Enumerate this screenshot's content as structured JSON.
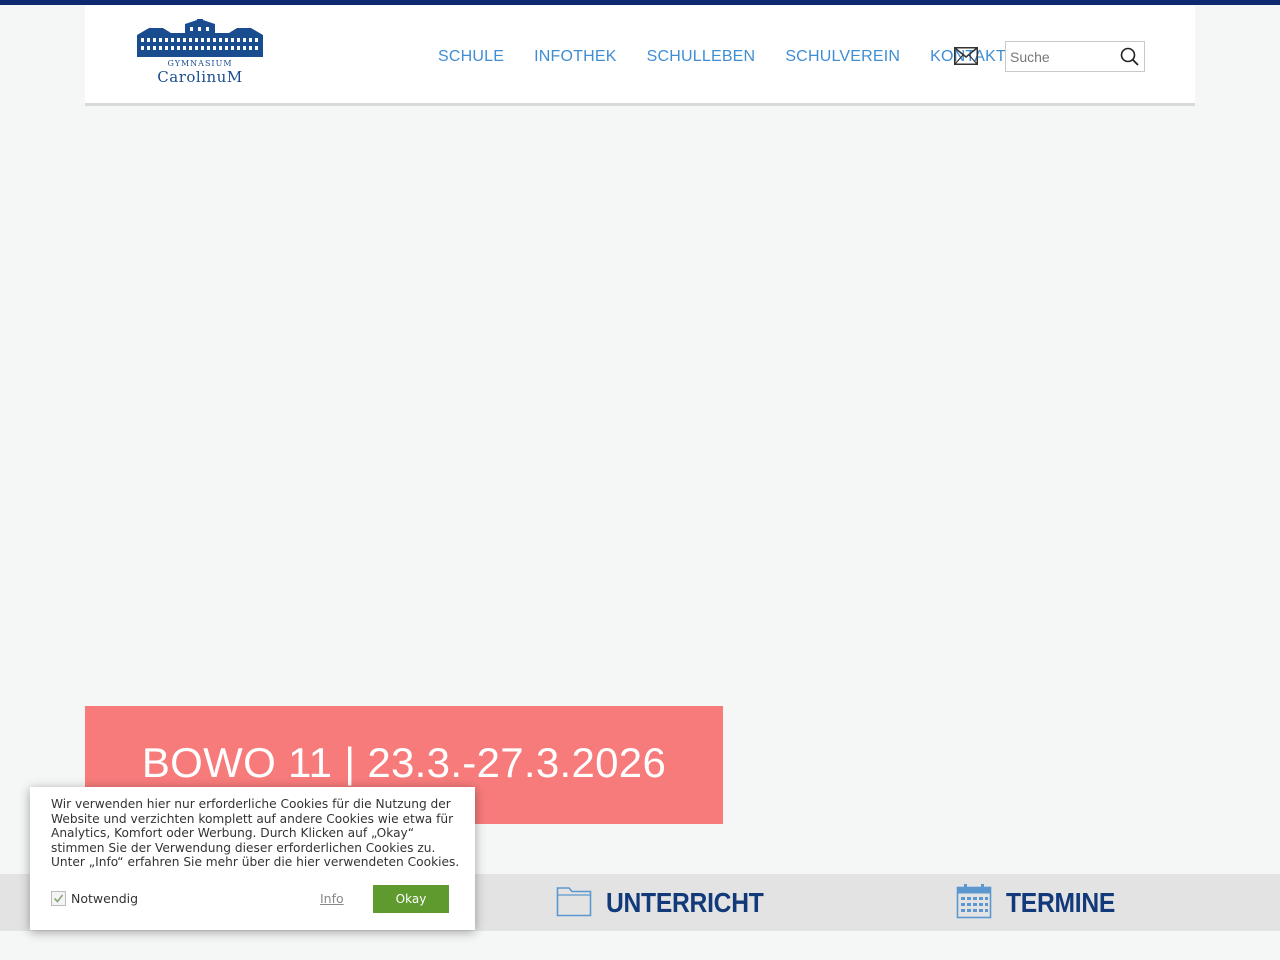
{
  "header": {
    "logo": {
      "line1": "GYMNASIUM",
      "line2": "CarolinuM"
    },
    "nav": [
      {
        "label": "SCHULE"
      },
      {
        "label": "INFOTHEK"
      },
      {
        "label": "SCHULLEBEN"
      },
      {
        "label": "SCHULVEREIN"
      },
      {
        "label": "KONTAKT"
      }
    ],
    "search": {
      "placeholder": "Suche"
    }
  },
  "banner": {
    "title": "BOWO 11 | 23.3.-27.3.2026"
  },
  "quicklinks": [
    {
      "label": "UNTERRICHT",
      "icon": "folder-icon"
    },
    {
      "label": "TERMINE",
      "icon": "calendar-icon"
    }
  ],
  "cookie": {
    "text": "Wir verwenden hier nur erforderliche Cookies für die Nutzung der Website und verzichten komplett auf andere Cookies wie etwa für Analytics, Komfort oder Werbung. Durch Klicken auf „Okay“ stimmen Sie der Verwendung dieser erforderlichen Cookies zu. Unter „Info“ erfahren Sie mehr über die hier verwendeten Cookies.",
    "checkbox_label": "Notwendig",
    "info_label": "Info",
    "okay_label": "Okay"
  },
  "colors": {
    "brand_dark": "#0d2a6e",
    "nav_link": "#3f8ed3",
    "banner": "#f77b7b",
    "okay_button": "#5f9a2e"
  }
}
